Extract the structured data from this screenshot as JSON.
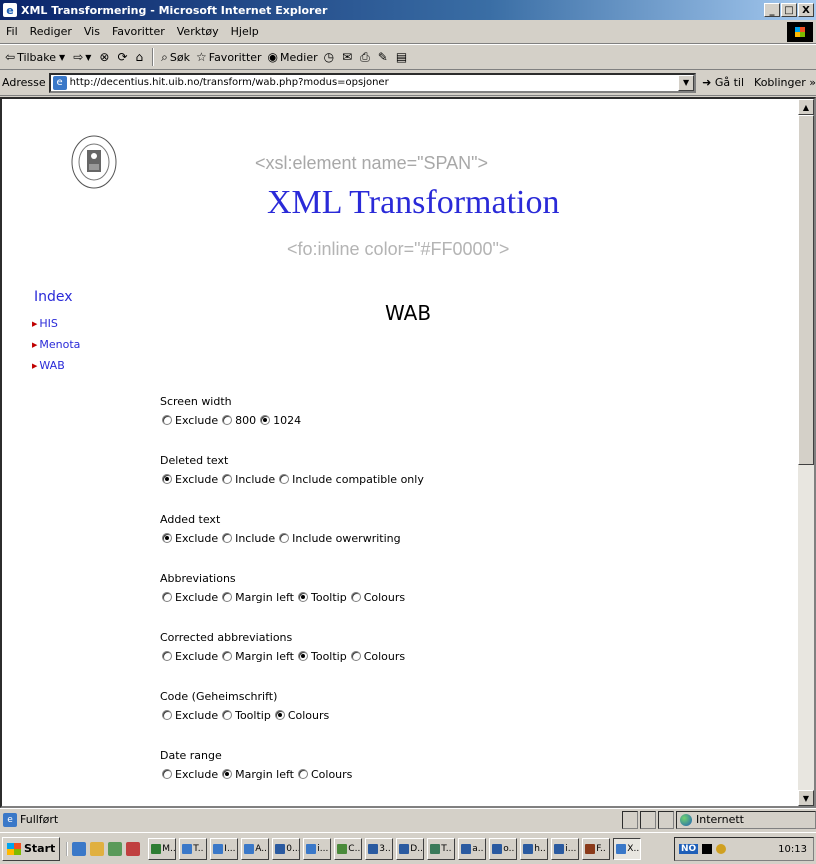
{
  "window": {
    "title": "XML Transformering - Microsoft Internet Explorer",
    "buttons": [
      "_",
      "□",
      "X"
    ]
  },
  "menu": [
    "Fil",
    "Rediger",
    "Vis",
    "Favoritter",
    "Verktøy",
    "Hjelp"
  ],
  "toolbar": {
    "back": "Tilbake",
    "search": "Søk",
    "favorites": "Favoritter",
    "media": "Medier"
  },
  "address": {
    "label": "Adresse",
    "url": "http://decentius.hit.uib.no/transform/wab.php?modus=opsjoner",
    "go": "Gå til",
    "links": "Koblinger"
  },
  "page": {
    "slogan_top": "<xsl:element name=\"SPAN\">",
    "title": "XML Transformation",
    "slogan_bottom": "<fo:inline color=\"#FF0000\">",
    "nav_heading": "Index",
    "nav_items": [
      "HIS",
      "Menota",
      "WAB"
    ],
    "heading": "WAB",
    "options": [
      {
        "label": "Screen width",
        "choices": [
          "Exclude",
          "800",
          "1024"
        ],
        "selected": 2
      },
      {
        "label": "Deleted text",
        "choices": [
          "Exclude",
          "Include",
          "Include compatible only"
        ],
        "selected": 0
      },
      {
        "label": "Added text",
        "choices": [
          "Exclude",
          "Include",
          "Include owerwriting"
        ],
        "selected": 0
      },
      {
        "label": "Abbreviations",
        "choices": [
          "Exclude",
          "Margin left",
          "Tooltip",
          "Colours"
        ],
        "selected": 2
      },
      {
        "label": "Corrected abbreviations",
        "choices": [
          "Exclude",
          "Margin left",
          "Tooltip",
          "Colours"
        ],
        "selected": 2
      },
      {
        "label": "Code (Geheimschrift)",
        "choices": [
          "Exclude",
          "Tooltip",
          "Colours"
        ],
        "selected": 2
      },
      {
        "label": "Date range",
        "choices": [
          "Exclude",
          "Margin left",
          "Colours"
        ],
        "selected": 1
      }
    ]
  },
  "status": {
    "text": "Fullført",
    "zone": "Internett"
  },
  "taskbar": {
    "start": "Start",
    "tasks": [
      "M..",
      "T..",
      "I...",
      "A..",
      "0...",
      "i...",
      "C..",
      "3..",
      "D..",
      "T..",
      "a..",
      "o..",
      "h..",
      "i...",
      "F..",
      "X..."
    ],
    "lang": "NO",
    "clock": "10:13"
  },
  "colors": {
    "link": "#2a2ad8",
    "title_bar": "#0a246a"
  }
}
